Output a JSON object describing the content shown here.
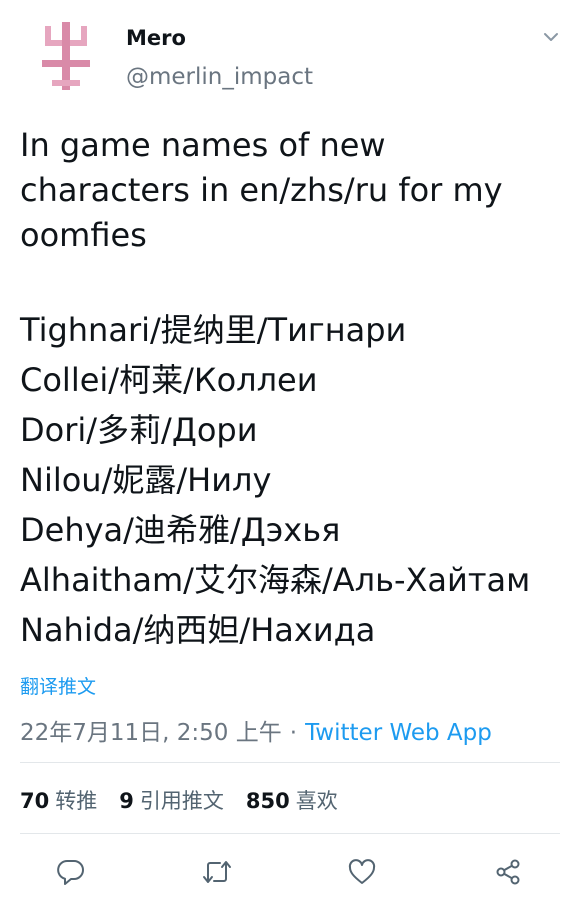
{
  "user": {
    "display_name": "Mero",
    "handle": "@merlin_impact",
    "avatar": "pink-cross-glyph-avatar"
  },
  "tweet": {
    "intro_lines": [
      "In game names of new",
      "characters in en/zhs/ru for my",
      "oomfies"
    ],
    "name_lines": [
      "Tighnari/提纳里/Тигнари",
      "Collei/柯莱/Коллеи",
      "Dori/多莉/Дори",
      "Nilou/妮露/Нилу",
      "Dehya/迪希雅/Дэхья",
      "Alhaitham/艾尔海森/Аль-Хайтам",
      "Nahida/纳西妲/Нахида"
    ],
    "translate_label": "翻译推文",
    "timestamp": "22年7月11日, 2:50 上午",
    "separator": "·",
    "source": "Twitter Web App"
  },
  "stats": {
    "retweets_count": "70",
    "retweets_label": "转推",
    "quotes_count": "9",
    "quotes_label": "引用推文",
    "likes_count": "850",
    "likes_label": "喜欢"
  },
  "icons": {
    "more": "chevron-down-icon",
    "reply": "reply-icon",
    "retweet": "retweet-icon",
    "like": "heart-icon",
    "share": "share-icon"
  },
  "colors": {
    "accent": "#1d9bf0",
    "secondary_text": "#6a7580",
    "avatar_pink": "#d98aa8"
  }
}
